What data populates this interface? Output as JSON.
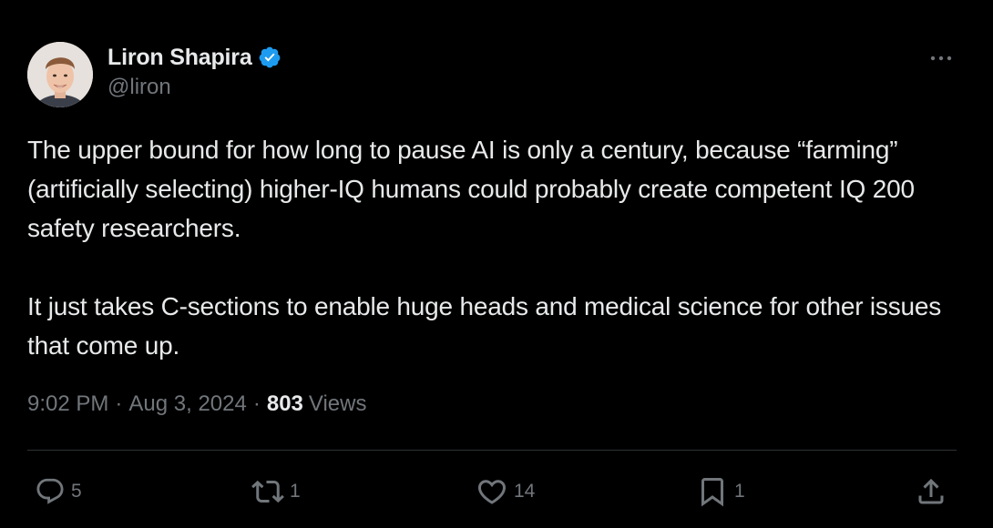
{
  "author": {
    "display_name": "Liron Shapira",
    "handle": "@liron",
    "verified": true
  },
  "tweet": {
    "paragraphs": [
      "The upper bound for how long to pause AI is only a century, because “farming” (artificially selecting) higher-IQ humans could probably create competent IQ 200 safety researchers.",
      "It just takes C-sections to enable huge heads and medical science for other issues that come up."
    ]
  },
  "meta": {
    "time": "9:02 PM",
    "separator": "·",
    "date": "Aug 3, 2024",
    "views_count": "803",
    "views_label": "Views"
  },
  "actions": {
    "reply_count": "5",
    "retweet_count": "1",
    "like_count": "14",
    "bookmark_count": "1"
  },
  "icons": {
    "verified": "verified-badge-icon",
    "more": "more-dots-icon",
    "reply": "reply-icon",
    "retweet": "retweet-icon",
    "like": "heart-icon",
    "bookmark": "bookmark-icon",
    "share": "share-icon"
  },
  "colors": {
    "background": "#000000",
    "text_primary": "#e7e9ea",
    "text_secondary": "#71767b",
    "verified_blue": "#1d9bf0",
    "divider": "#2f3336"
  }
}
